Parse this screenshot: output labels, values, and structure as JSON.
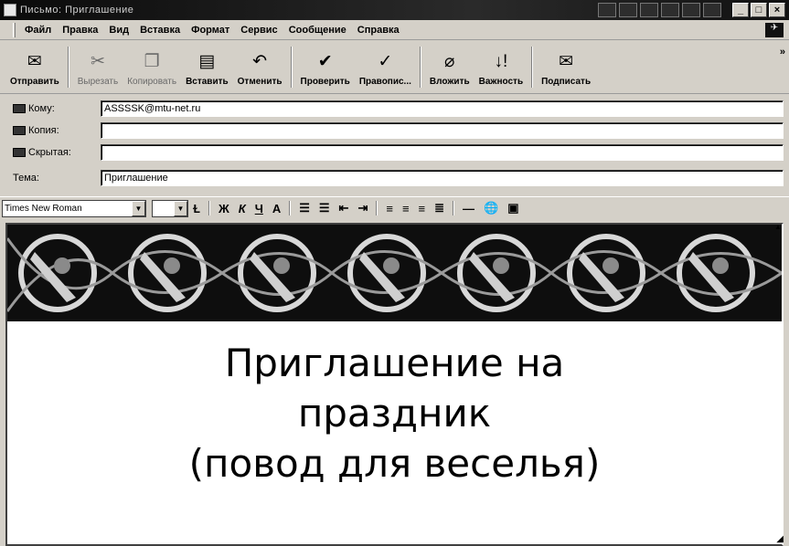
{
  "window": {
    "title": "Письмо: Приглашение"
  },
  "menu": [
    "Файл",
    "Правка",
    "Вид",
    "Вставка",
    "Формат",
    "Сервис",
    "Сообщение",
    "Справка"
  ],
  "toolbar": {
    "send": "Отправить",
    "cut": "Вырезать",
    "copy": "Копировать",
    "paste": "Вставить",
    "undo": "Отменить",
    "check": "Проверить",
    "spelling": "Правопис...",
    "attach": "Вложить",
    "priority": "Важность",
    "sign": "Подписать"
  },
  "headers": {
    "to_label": "Кому:",
    "to_value": "ASSSSK@mtu-net.ru",
    "cc_label": "Копия:",
    "cc_value": "",
    "bcc_label": "Скрытая:",
    "bcc_value": "",
    "subject_label": "Тема:",
    "subject_value": "Приглашение"
  },
  "format": {
    "font": "Times New Roman",
    "size": ""
  },
  "body": {
    "line1": "Приглашение на",
    "line2": "праздник",
    "line3": "(повод для веселья)"
  }
}
